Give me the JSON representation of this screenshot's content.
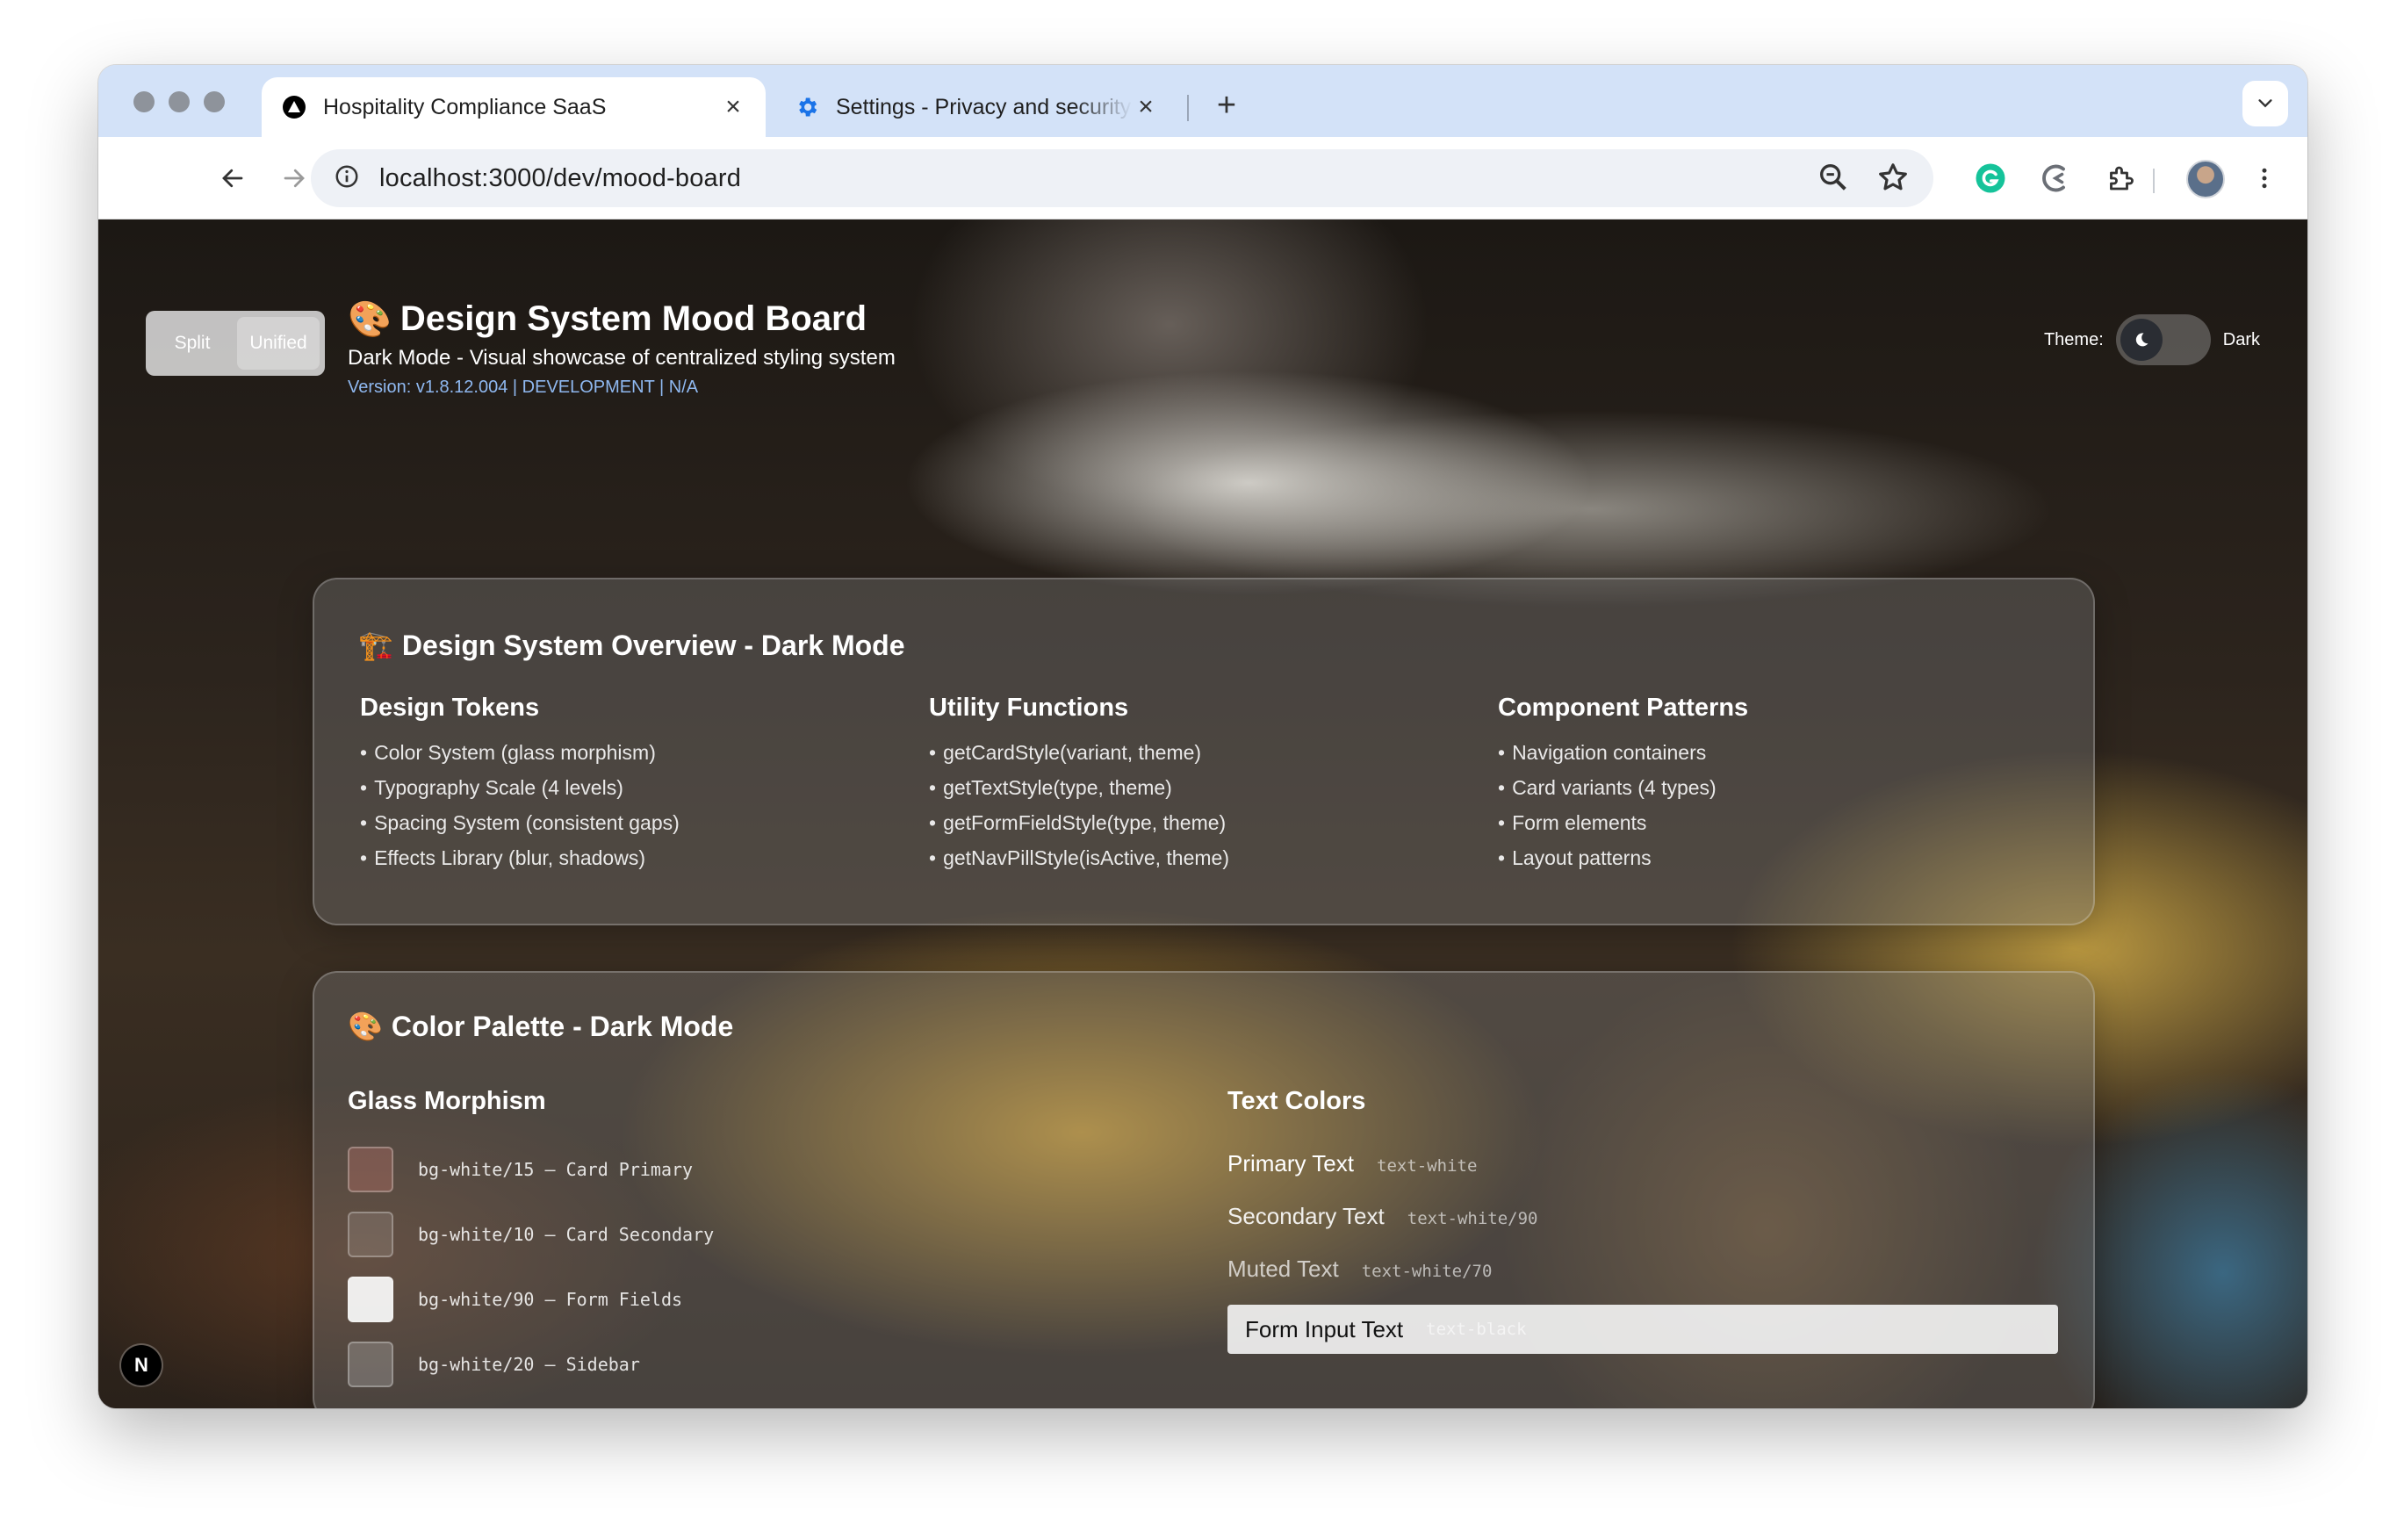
{
  "browser": {
    "tabs": [
      {
        "title": "Hospitality Compliance SaaS",
        "favicon": "vercel-triangle-icon",
        "active": true
      },
      {
        "title": "Settings - Privacy and security",
        "favicon": "settings-gear-icon",
        "active": false
      }
    ],
    "new_tab": "+",
    "url": "localhost:3000/dev/mood-board",
    "icons": {
      "back": "arrow-left-icon",
      "forward": "arrow-right-icon",
      "reload": "reload-icon",
      "site_info": "info-circle-icon",
      "zoom": "zoom-icon",
      "bookmark": "star-icon",
      "grammarly": "grammarly-icon",
      "extension_loader": "loader-extension-icon",
      "extensions": "puzzle-icon",
      "menu": "kebab-menu-icon"
    }
  },
  "header": {
    "view_toggle": {
      "split": "Split",
      "unified": "Unified",
      "active": "Unified"
    },
    "emoji": "🎨",
    "title": "Design System Mood Board",
    "subtitle": "Dark Mode - Visual showcase of centralized styling system",
    "version": "Version: v1.8.12.004 | DEVELOPMENT | N/A",
    "theme_label": "Theme:",
    "theme_value": "Dark"
  },
  "overview": {
    "emoji": "🏗️",
    "title": "Design System Overview - Dark Mode",
    "columns": [
      {
        "heading": "Design Tokens",
        "items": [
          "Color System (glass morphism)",
          "Typography Scale (4 levels)",
          "Spacing System (consistent gaps)",
          "Effects Library (blur, shadows)"
        ]
      },
      {
        "heading": "Utility Functions",
        "items": [
          "getCardStyle(variant, theme)",
          "getTextStyle(type, theme)",
          "getFormFieldStyle(type, theme)",
          "getNavPillStyle(isActive, theme)"
        ]
      },
      {
        "heading": "Component Patterns",
        "items": [
          "Navigation containers",
          "Card variants (4 types)",
          "Form elements",
          "Layout patterns"
        ]
      }
    ]
  },
  "palette": {
    "emoji": "🎨",
    "title": "Color Palette - Dark Mode",
    "glass_heading": "Glass Morphism",
    "glass": [
      {
        "label": "bg-white/15 – Card Primary",
        "color": "rgba(255,255,255,0.15)"
      },
      {
        "label": "bg-white/10 – Card Secondary",
        "color": "rgba(255,255,255,0.10)"
      },
      {
        "label": "bg-white/90 – Form Fields",
        "color": "rgba(255,255,255,0.90)"
      },
      {
        "label": "bg-white/20 – Sidebar",
        "color": "rgba(255,255,255,0.20)"
      }
    ],
    "text_heading": "Text Colors",
    "text_colors": [
      {
        "sample": "Primary Text",
        "class": "text-white",
        "color": "#ffffff"
      },
      {
        "sample": "Secondary Text",
        "class": "text-white/90",
        "color": "rgba(255,255,255,0.90)"
      },
      {
        "sample": "Muted Text",
        "class": "text-white/70",
        "color": "rgba(255,255,255,0.70)"
      }
    ],
    "form_input": {
      "sample": "Form Input Text",
      "class": "text-black"
    }
  },
  "next_badge": "N"
}
